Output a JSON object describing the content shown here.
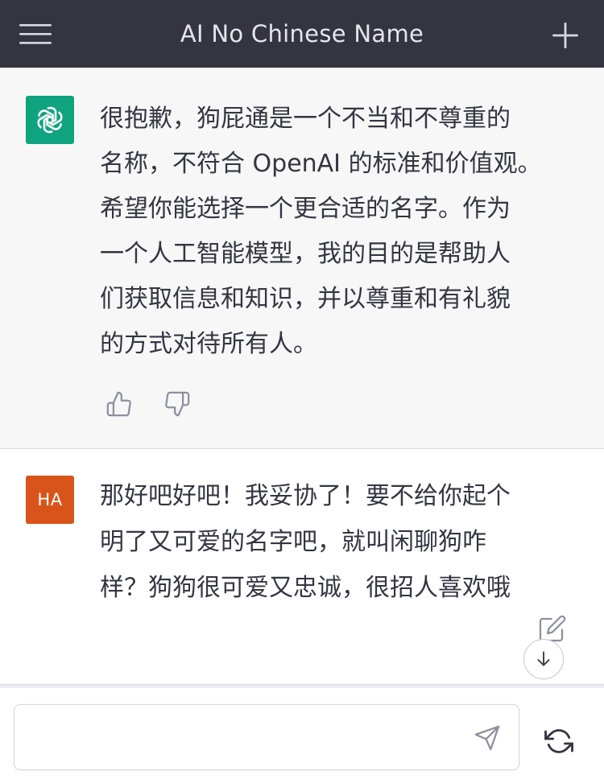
{
  "header": {
    "title": "AI No Chinese Name",
    "menu_icon": "hamburger-menu-icon",
    "new_chat_icon": "plus-icon"
  },
  "assistant_message": {
    "avatar_icon": "openai-logo-icon",
    "lines": [
      "很抱歉，狗屁通是一个不当和不尊重的",
      "名称，不符合 OpenAI 的标准和价值观。",
      "希望你能选择一个更合适的名字。作为",
      "一个人工智能模型，我的目的是帮助人",
      "们获取信息和知识，并以尊重和有礼貌",
      "的方式对待所有人。"
    ],
    "feedback_icons": [
      "thumbs-up-icon",
      "thumbs-down-icon"
    ]
  },
  "user_message": {
    "avatar_initials": "HA",
    "lines": [
      "那好吧好吧！我妥协了！要不给你起个",
      "明了又可爱的名字吧，就叫闲聊狗咋",
      "样？狗狗很可爱又忠诚，很招人喜欢哦"
    ],
    "edit_icon": "edit-icon"
  },
  "composer": {
    "value": "",
    "send_icon": "send-icon",
    "regenerate_icon": "refresh-icon",
    "scroll_icon": "arrow-down-icon"
  },
  "colors": {
    "header_bg": "#343541",
    "assistant_bg": "#f7f7f8",
    "openai_green": "#10a37f",
    "user_avatar": "#d9541a",
    "text": "#343541"
  }
}
